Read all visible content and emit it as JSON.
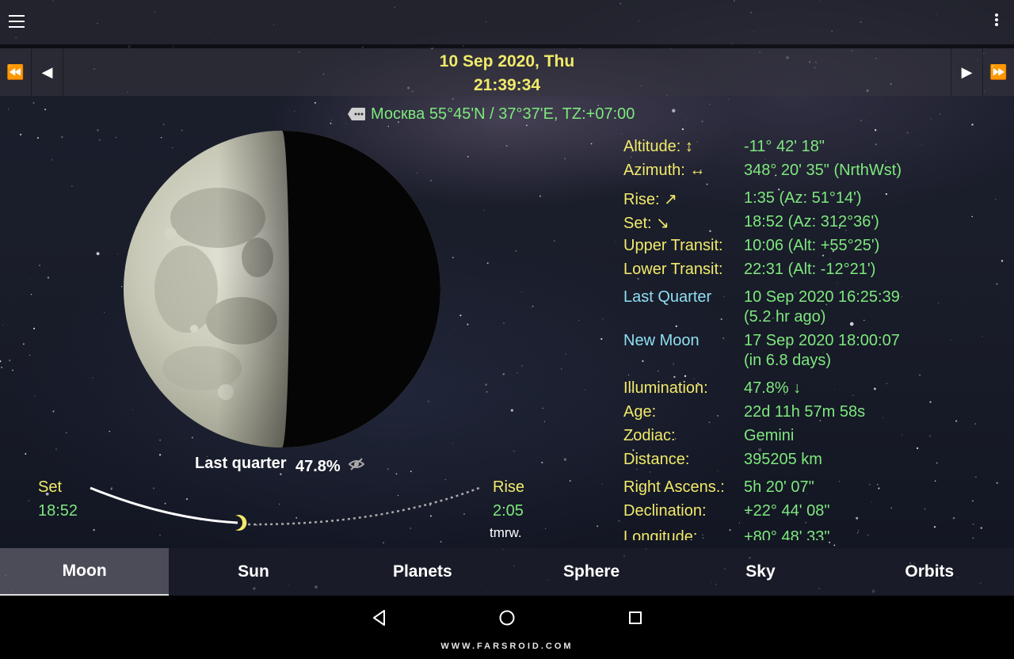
{
  "header": {
    "menu_icon": "hamburger-menu-icon",
    "overflow_icon": "more-vert-icon"
  },
  "datebar": {
    "date": "10 Sep 2020,  Thu",
    "time": "21:39:34",
    "fast_back_icon": "⏪",
    "back_icon": "◀",
    "forward_icon": "▶",
    "fast_forward_icon": "⏩"
  },
  "location": {
    "text": "Москва  55°45'N  /  37°37'E, TZ:+07:00",
    "icon": "tag-icon"
  },
  "moon": {
    "phase": "Last quarter",
    "illumination": "47.8%",
    "illuminated_fraction": 0.478
  },
  "rise_set": {
    "set_label": "Set",
    "set_time": "18:52",
    "rise_label": "Rise",
    "rise_time": "2:05",
    "rise_note": "tmrw."
  },
  "info": {
    "altitude_label": "Altitude: ↕",
    "altitude_value": "-11° 42' 18\"",
    "azimuth_label": "Azimuth: ↔",
    "azimuth_value": "348° 20' 35\" (NrthWst)",
    "rise_label": "Rise: ↗",
    "rise_value": "1:35 (Az: 51°14')",
    "set_label": "Set: ↘",
    "set_value": "18:52 (Az: 312°36')",
    "upper_transit_label": "Upper Transit:",
    "upper_transit_value": "10:06 (Alt: +55°25')",
    "lower_transit_label": "Lower Transit:",
    "lower_transit_value": "22:31 (Alt: -12°21')",
    "last_quarter_label": "Last Quarter",
    "last_quarter_value": "10 Sep 2020  16:25:39",
    "last_quarter_note": "(5.2 hr ago)",
    "new_moon_label": "New Moon",
    "new_moon_value": "17 Sep 2020  18:00:07",
    "new_moon_note": "(in 6.8 days)",
    "illumination_label": "Illumination:",
    "illumination_value": "47.8% ↓",
    "age_label": "Age:",
    "age_value": "22d 11h 57m 58s",
    "zodiac_label": "Zodiac:",
    "zodiac_value": "Gemini",
    "distance_label": "Distance:",
    "distance_value": "395205 km",
    "ra_label": "Right Ascens.:",
    "ra_value": "5h 20' 07\"",
    "dec_label": "Declination:",
    "dec_value": "+22° 44' 08\"",
    "longitude_label": "Longitude:",
    "longitude_value": "+80° 48' 33\""
  },
  "tabs": [
    {
      "label": "Moon",
      "active": true
    },
    {
      "label": "Sun",
      "active": false
    },
    {
      "label": "Planets",
      "active": false
    },
    {
      "label": "Sphere",
      "active": false
    },
    {
      "label": "Sky",
      "active": false
    },
    {
      "label": "Orbits",
      "active": false
    }
  ],
  "system_nav": {
    "back_icon": "back-triangle-icon",
    "home_icon": "home-circle-icon",
    "recents_icon": "recents-square-icon"
  },
  "watermark": "WWW.FARSROID.COM",
  "colors": {
    "yellow": "#f1ea6a",
    "green": "#7ee87e",
    "cyan": "#8fdff2",
    "white": "#ffffff"
  }
}
